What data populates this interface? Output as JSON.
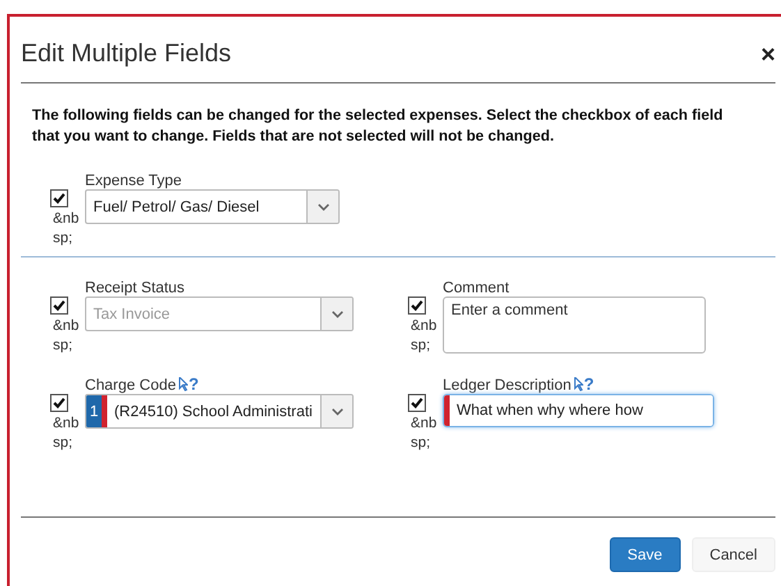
{
  "dialog": {
    "title": "Edit Multiple Fields",
    "close": "×",
    "intro": "The following fields can be changed for the selected expenses. Select the checkbox of each field that you want to change. Fields that are not selected will not be changed.",
    "rows": [
      {
        "fields": [
          {
            "kind": "select",
            "label": "Expense Type",
            "checked": true,
            "note": "&nbsp;",
            "value": "Fuel/ Petrol/ Gas/ Diesel"
          }
        ]
      },
      {
        "fields": [
          {
            "kind": "select",
            "label": "Receipt Status",
            "checked": true,
            "note": "&nbsp;",
            "value": "Tax Invoice",
            "disabled": true
          },
          {
            "kind": "textarea",
            "label": "Comment",
            "checked": true,
            "note": "&nbsp;",
            "placeholder": "Enter a comment"
          }
        ]
      },
      {
        "fields": [
          {
            "kind": "select",
            "label": "Charge Code",
            "checked": true,
            "note": "&nbsp;",
            "help": "?",
            "badge": "1",
            "required": true,
            "value": "(R24510) School Administrati"
          },
          {
            "kind": "input",
            "label": "Ledger Description",
            "checked": true,
            "note": "&nbsp;",
            "help": "?",
            "required": true,
            "focused": true,
            "value": "What when why where how"
          }
        ]
      }
    ],
    "buttons": [
      {
        "label": "Save",
        "kind": "primary"
      },
      {
        "label": "Cancel",
        "kind": "plain"
      }
    ]
  }
}
